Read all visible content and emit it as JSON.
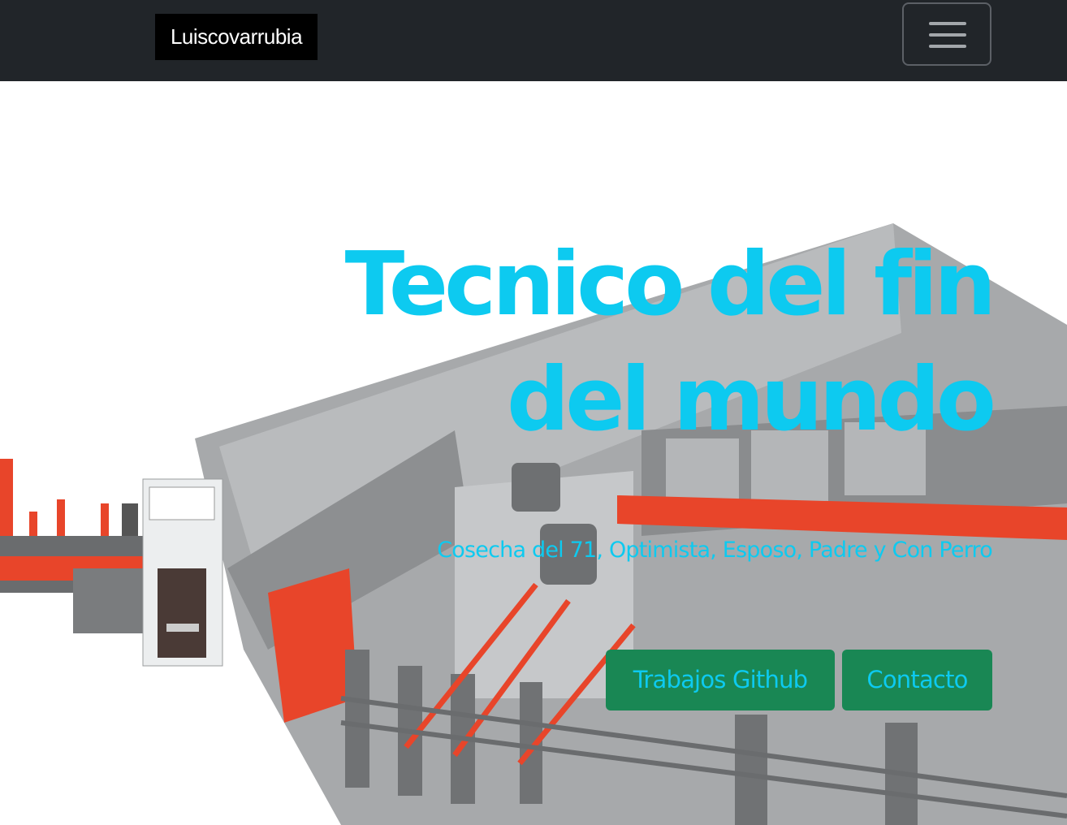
{
  "navbar": {
    "brand": "Luiscovarrubia",
    "toggler_icon": "hamburger-menu-icon"
  },
  "hero": {
    "title": "Tecnico del fin del mundo",
    "subtitle": "Cosecha del 71, Optimista, Esposo, Padre y Con Perro",
    "buttons": [
      {
        "label": "Trabajos Github"
      },
      {
        "label": "Contacto"
      }
    ]
  },
  "colors": {
    "navbar_bg": "#212529",
    "accent_text": "#0dcaf0",
    "button_bg": "#198754",
    "machine_orange": "#e8452a",
    "machine_gray": "#9a9c9e"
  }
}
